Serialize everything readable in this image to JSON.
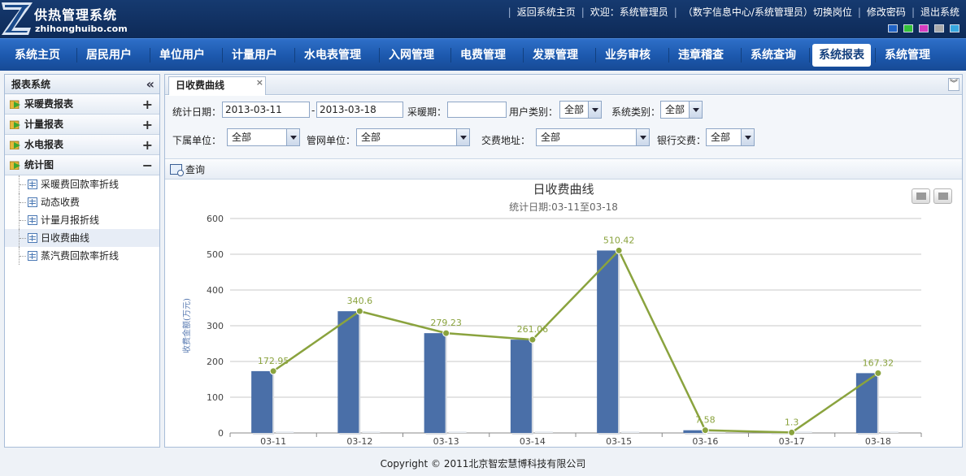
{
  "header": {
    "logo_letter": "Z",
    "title": "供热管理系统",
    "subtitle": "zhihonghuibo.com",
    "links": {
      "home": "返回系统主页",
      "welcome": "欢迎：系统管理员",
      "role": "（数字信息中心/系统管理员）切换岗位",
      "password": "修改密码",
      "logout": "退出系统"
    },
    "skins": [
      "#1f63c6",
      "#34c13a",
      "#d63ec0",
      "#aaaaaa",
      "#37a7df"
    ]
  },
  "nav": {
    "items": [
      "系统主页",
      "居民用户",
      "单位用户",
      "计量用户",
      "水电表管理",
      "入网管理",
      "电费管理",
      "发票管理",
      "业务审核",
      "违章稽查",
      "系统查询",
      "系统报表",
      "系统管理"
    ],
    "active": "系统报表"
  },
  "sidebar": {
    "title": "报表系统",
    "groups": [
      {
        "label": "采暖费报表",
        "toggle": "+"
      },
      {
        "label": "计量报表",
        "toggle": "+"
      },
      {
        "label": "水电报表",
        "toggle": "+"
      },
      {
        "label": "统计图",
        "toggle": "−"
      }
    ],
    "leaves": [
      "采暖费回款率折线",
      "动态收费",
      "计量月报折线",
      "日收费曲线",
      "蒸汽费回款率折线"
    ],
    "active_leaf": "日收费曲线"
  },
  "tab": {
    "label": "日收费曲线",
    "close": "×"
  },
  "filters": {
    "date_label": "统计日期：",
    "date_from": "2013-03-11",
    "date_sep": "-",
    "date_to": "2013-03-18",
    "season_label": "采暖期：",
    "season_value": "",
    "user_type_label": "用户类别：",
    "user_type_value": "全部",
    "system_type_label": "系统类别：",
    "system_type_value": "全部",
    "sub_unit_label": "下属单位：",
    "sub_unit_value": "全部",
    "network_unit_label": "管网单位：",
    "network_unit_value": "全部",
    "pay_address_label": "交费地址：",
    "pay_address_value": "全部",
    "bank_label": "银行交费：",
    "bank_value": "全部"
  },
  "toolbar": {
    "query": "查询"
  },
  "chart_data": {
    "type": "bar",
    "title": "日收费曲线",
    "subtitle": "统计日期:03-11至03-18",
    "ylabel": "收费金额(万元)",
    "xlabel": "",
    "ylim": [
      0,
      600
    ],
    "yticks": [
      0,
      100,
      200,
      300,
      400,
      500,
      600
    ],
    "categories": [
      "03-11",
      "03-12",
      "03-13",
      "03-14",
      "03-15",
      "03-16",
      "03-17",
      "03-18"
    ],
    "series": [
      {
        "type": "bar",
        "values": [
          172.95,
          340.6,
          279.23,
          261.06,
          510.42,
          7.58,
          1.3,
          167.32
        ],
        "color": "#4a6fa8"
      },
      {
        "type": "line",
        "values": [
          172.95,
          340.6,
          279.23,
          261.06,
          510.42,
          7.58,
          1.3,
          167.32
        ],
        "color": "#8aa33e"
      }
    ],
    "data_labels": [
      "172.95",
      "340.6",
      "279.23",
      "261.06",
      "510.42",
      "7.58",
      "1.3",
      "167.32"
    ],
    "grid": true
  },
  "footer": "Copyright © 2011北京智宏慧博科技有限公司"
}
